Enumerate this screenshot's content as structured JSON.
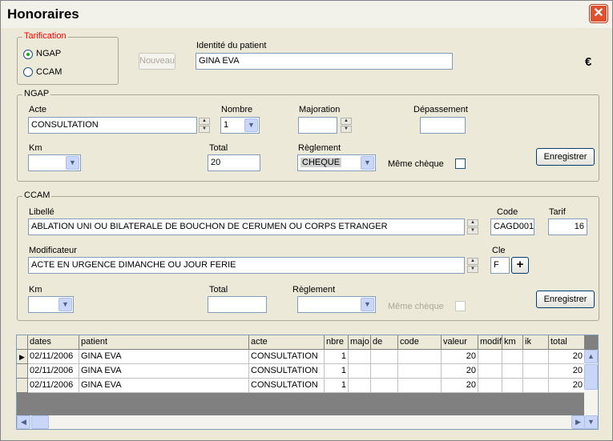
{
  "window": {
    "title": "Honoraires",
    "close": "✕"
  },
  "tarif": {
    "legend": "Tarification",
    "opt1": "NGAP",
    "opt2": "CCAM",
    "selected": "NGAP"
  },
  "nouveau": "Nouveau",
  "patient": {
    "label": "Identité du patient",
    "value": "GINA EVA"
  },
  "currency": "€",
  "ngap": {
    "legend": "NGAP",
    "acte_label": "Acte",
    "acte_value": "CONSULTATION",
    "nombre_label": "Nombre",
    "nombre_value": "1",
    "majoration_label": "Majoration",
    "depassement_label": "Dépassement",
    "km_label": "Km",
    "total_label": "Total",
    "total_value": "20",
    "reglement_label": "Règlement",
    "reglement_value": "CHEQUE",
    "meme_cheque": "Même chèque",
    "save": "Enregistrer"
  },
  "ccam": {
    "legend": "CCAM",
    "libelle_label": "Libellé",
    "libelle_value": "ABLATION UNI OU BILATERALE DE BOUCHON DE CERUMEN OU  CORPS ETRANGER",
    "code_label": "Code",
    "code_value": "CAGD001",
    "tarif_label": "Tarif",
    "tarif_value": "16",
    "modificateur_label": "Modificateur",
    "modificateur_value": "ACTE EN URGENCE DIMANCHE OU JOUR FERIE",
    "cle_label": "Cle",
    "cle_value": "F",
    "plus": "+",
    "km_label": "Km",
    "total_label": "Total",
    "reglement_label": "Règlement",
    "meme_cheque": "Même chèque",
    "save": "Enregistrer"
  },
  "grid": {
    "columns": [
      "dates",
      "patient",
      "acte",
      "nbre",
      "majo",
      "de",
      "code",
      "valeur",
      "modif",
      "km",
      "ik",
      "total"
    ],
    "rows": [
      [
        "02/11/2006",
        "GINA EVA",
        "CONSULTATION",
        "1",
        "",
        "",
        "",
        "20",
        "",
        "",
        "",
        "20"
      ],
      [
        "02/11/2006",
        "GINA EVA",
        "CONSULTATION",
        "1",
        "",
        "",
        "",
        "20",
        "",
        "",
        "",
        "20"
      ],
      [
        "02/11/2006",
        "GINA EVA",
        "CONSULTATION",
        "1",
        "",
        "",
        "",
        "20",
        "",
        "",
        "",
        "20"
      ]
    ]
  },
  "colors": {
    "tarif_legend": "#ff0000",
    "disabled_text": "#aca899"
  }
}
